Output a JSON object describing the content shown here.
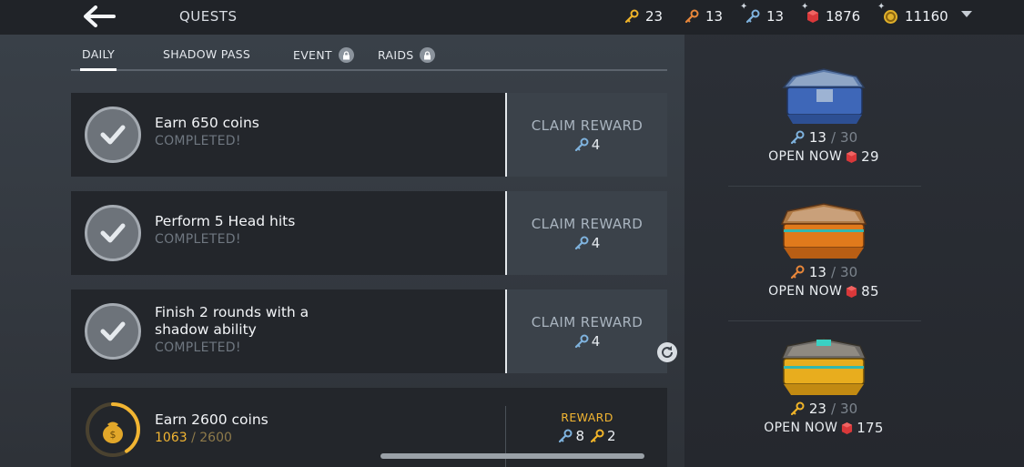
{
  "header": {
    "title": "QUESTS",
    "currencies": [
      {
        "name": "gold-keys",
        "value": "23",
        "icon": "gold-key-icon",
        "color": "#f0b429",
        "plus": false
      },
      {
        "name": "bronze-keys",
        "value": "13",
        "icon": "bronze-key-icon",
        "color": "#e8873a",
        "plus": false
      },
      {
        "name": "silver-keys",
        "value": "13",
        "icon": "silver-key-icon",
        "color": "#7fb3de",
        "plus": true
      },
      {
        "name": "gems",
        "value": "1876",
        "icon": "ruby-gem-icon",
        "color": "#d9383a",
        "plus": true
      },
      {
        "name": "coins",
        "value": "11160",
        "icon": "coin-icon",
        "color": "#e0b02a",
        "plus": true
      }
    ]
  },
  "tabs": [
    {
      "label": "DAILY",
      "active": true,
      "locked": false
    },
    {
      "label": "SHADOW PASS",
      "active": false,
      "locked": false
    },
    {
      "label": "EVENT",
      "active": false,
      "locked": true
    },
    {
      "label": "RAIDS",
      "active": false,
      "locked": true
    }
  ],
  "quests": [
    {
      "title_line1": "Earn 650 coins",
      "title_line2": "",
      "status": "COMPLETED!",
      "claim_label": "CLAIM REWARD",
      "reward": "4"
    },
    {
      "title_line1": "Perform 5 Head hits",
      "title_line2": "",
      "status": "COMPLETED!",
      "claim_label": "CLAIM REWARD",
      "reward": "4"
    },
    {
      "title_line1": "Finish 2 rounds with a",
      "title_line2": "shadow ability",
      "status": "COMPLETED!",
      "claim_label": "CLAIM REWARD",
      "reward": "4"
    }
  ],
  "active_quest": {
    "title": "Earn 2600 coins",
    "progress_current": "1063",
    "progress_separator": "/",
    "progress_total": "2600",
    "progress_fraction": 0.409,
    "reward_label": "REWARD",
    "reward_silver": "8",
    "reward_gold": "2"
  },
  "chests": [
    {
      "name": "silver-chest",
      "keys": "13",
      "separator": "/",
      "max": "30",
      "open_label": "OPEN NOW",
      "gem_cost": "29",
      "key_color": "#7fb3de"
    },
    {
      "name": "bronze-chest",
      "keys": "13",
      "separator": "/",
      "max": "30",
      "open_label": "OPEN NOW",
      "gem_cost": "85",
      "key_color": "#e8873a"
    },
    {
      "name": "gold-chest",
      "keys": "23",
      "separator": "/",
      "max": "30",
      "open_label": "OPEN NOW",
      "gem_cost": "175",
      "key_color": "#f0b429"
    }
  ]
}
